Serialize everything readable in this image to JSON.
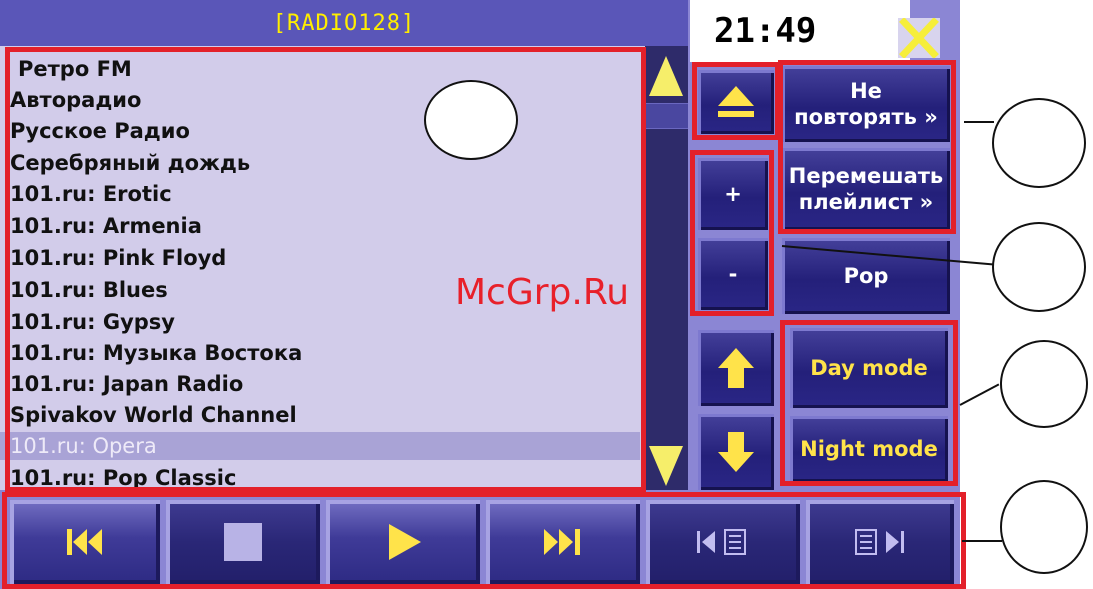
{
  "window": {
    "title": "[RADIO128]",
    "clock": "21:49"
  },
  "playlist": {
    "items": [
      {
        "label": "Ретро FM"
      },
      {
        "label": "Авторадио"
      },
      {
        "label": "Русское Радио"
      },
      {
        "label": "Серебряный дождь"
      },
      {
        "label": "101.ru: Erotic"
      },
      {
        "label": "101.ru: Armenia"
      },
      {
        "label": "101.ru: Pink Floyd"
      },
      {
        "label": "101.ru: Blues"
      },
      {
        "label": "101.ru: Gypsy"
      },
      {
        "label": "101.ru: Музыка Востока"
      },
      {
        "label": "101.ru: Japan Radio"
      },
      {
        "label": "Spivakov World Channel"
      },
      {
        "label": "101.ru: Opera",
        "selected": true
      },
      {
        "label": "101.ru: Pop Classic"
      }
    ]
  },
  "controls": {
    "no_repeat": "Не повторять »",
    "shuffle": "Перемешать плейлист »",
    "volume_plus": "+",
    "volume_minus": "-",
    "genre": "Pop",
    "day_mode": "Day mode",
    "night_mode": "Night mode"
  },
  "transport": [
    "previous",
    "stop",
    "play",
    "next",
    "prev-list",
    "next-list"
  ],
  "watermark": "McGrp.Ru",
  "colors": {
    "accent": "#ffe34a",
    "panel": "#8b86d4",
    "list_bg": "#d2ccea",
    "selection": "#a9a3d6",
    "annotation_red": "#e3202a"
  }
}
